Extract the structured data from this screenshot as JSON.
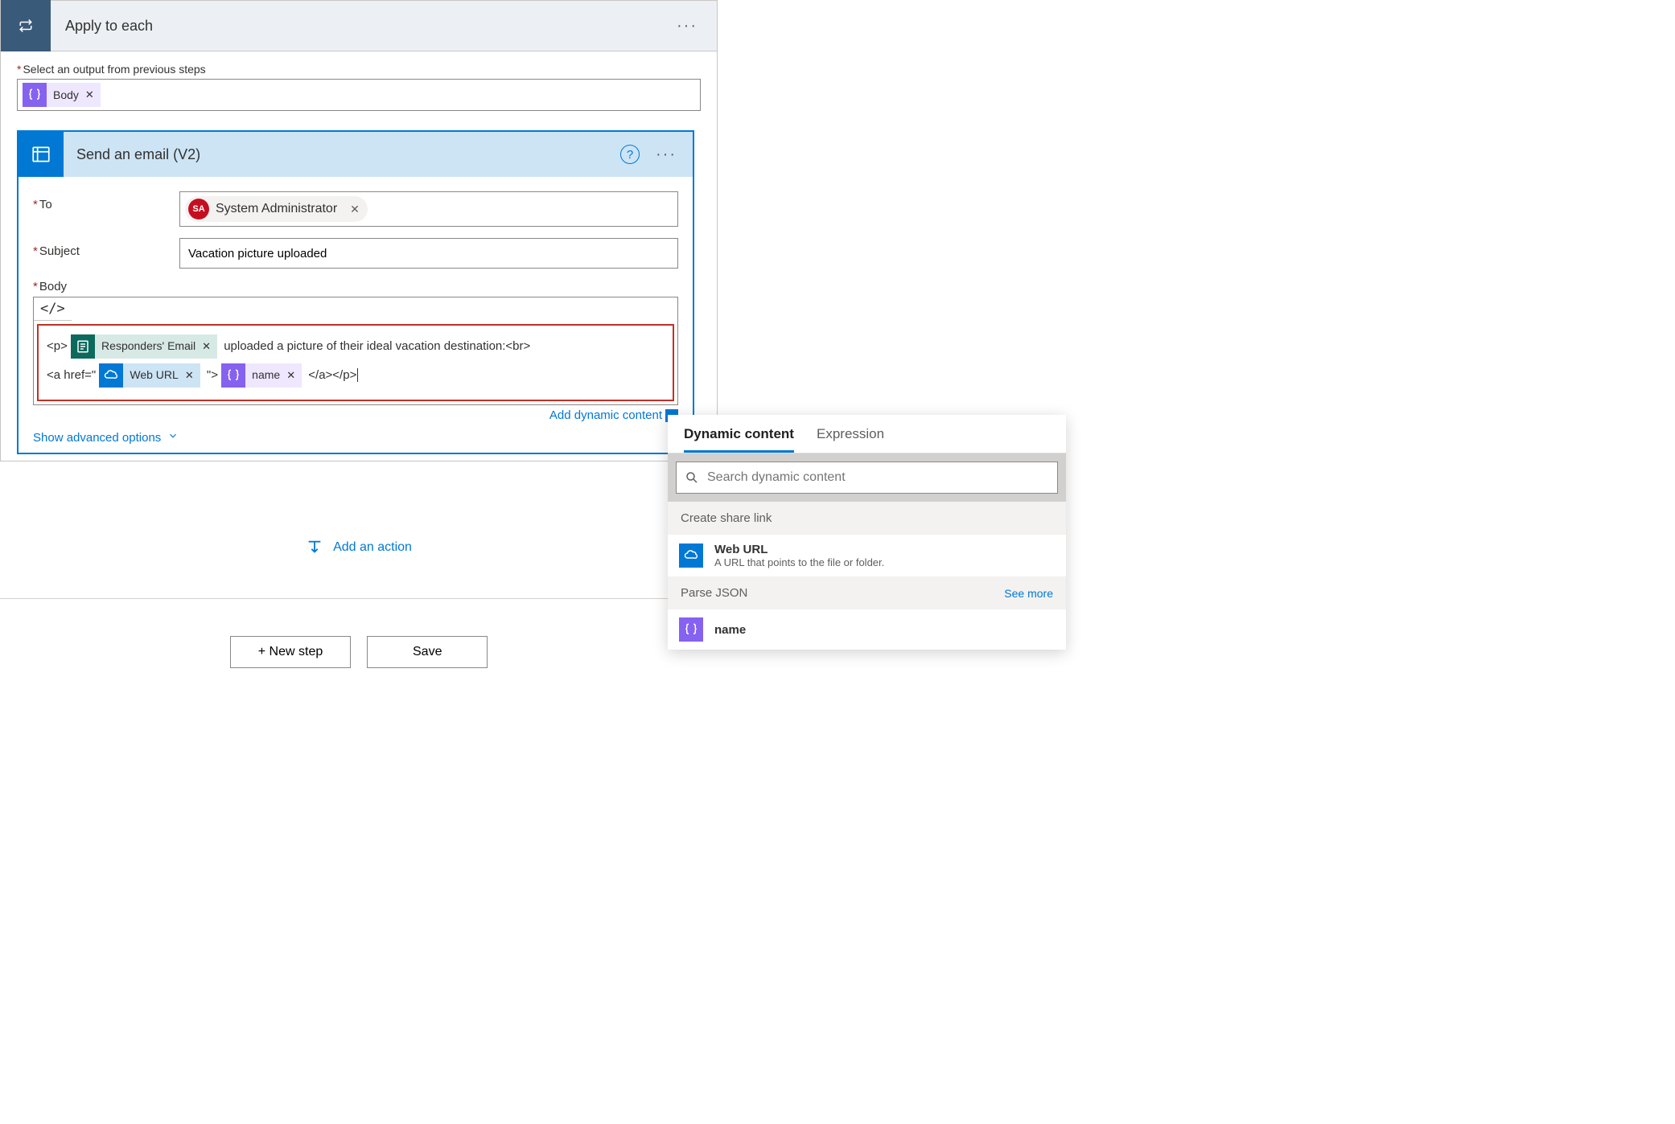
{
  "outer": {
    "title": "Apply to each",
    "select_label": "Select an output from previous steps",
    "body_token": "Body"
  },
  "email": {
    "title": "Send an email (V2)",
    "to_label": "To",
    "to_person_initials": "SA",
    "to_person_name": "System Administrator",
    "subject_label": "Subject",
    "subject_value": "Vacation picture uploaded",
    "body_label": "Body",
    "code_toggle": "</>",
    "body_code": {
      "pre1": "<p>",
      "token_forms": "Responders' Email",
      "mid1": " uploaded a picture of their ideal vacation destination:<br>",
      "pre2": "<a href=\"",
      "token_weburl": "Web URL",
      "mid2": "\">",
      "token_name": "name",
      "post": "</a></p>"
    },
    "add_dynamic": "Add dynamic content",
    "show_advanced": "Show advanced options"
  },
  "add_action": "Add an action",
  "footer": {
    "new_step": "+ New step",
    "save": "Save"
  },
  "dyn": {
    "tab_dynamic": "Dynamic content",
    "tab_expression": "Expression",
    "search_placeholder": "Search dynamic content",
    "section1": "Create share link",
    "item1_name": "Web URL",
    "item1_desc": "A URL that points to the file or folder.",
    "section2": "Parse JSON",
    "see_more": "See more",
    "item2_name": "name"
  }
}
